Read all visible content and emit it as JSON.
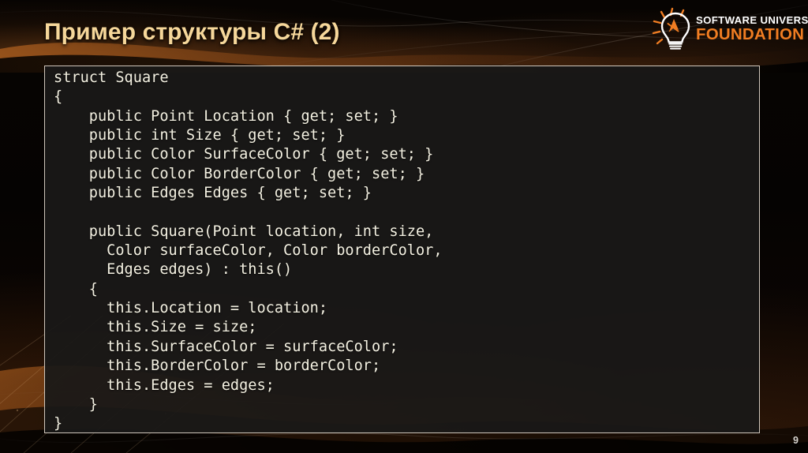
{
  "slide": {
    "title": "Пример структуры C# (2)",
    "page_number": "9",
    "title_color": "#f6d79a",
    "code_text_color": "#f4f1e2",
    "code_bg_color": "#1a1918",
    "code_border_color": "#cfc6bb"
  },
  "logo": {
    "line1": "SOFTWARE UNIVERSITY",
    "line2": "FOUNDATION",
    "icon": "lightbulb-icon",
    "line1_color": "#ffffff",
    "line2_color": "#f07d22"
  },
  "code": {
    "language": "csharp",
    "body": "struct Square\n{\n    public Point Location { get; set; }\n    public int Size { get; set; }\n    public Color SurfaceColor { get; set; }\n    public Color BorderColor { get; set; }\n    public Edges Edges { get; set; }\n\n    public Square(Point location, int size,\n      Color surfaceColor, Color borderColor,\n      Edges edges) : this()\n    {\n      this.Location = location;\n      this.Size = size;\n      this.SurfaceColor = surfaceColor;\n      this.BorderColor = borderColor;\n      this.Edges = edges;\n    }\n}"
  }
}
